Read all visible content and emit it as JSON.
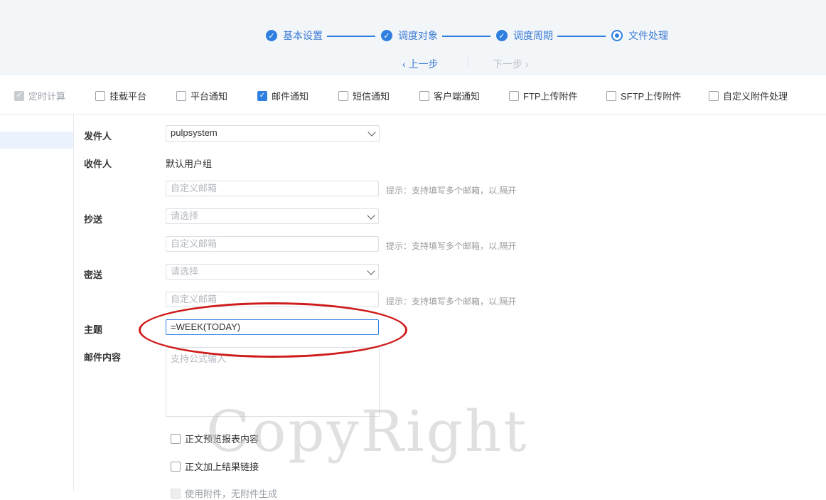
{
  "wizard": {
    "steps": [
      {
        "label": "基本设置"
      },
      {
        "label": "调度对象"
      },
      {
        "label": "调度周期"
      },
      {
        "label": "文件处理"
      }
    ],
    "prev_label": "上一步",
    "next_label": "下一步"
  },
  "options": [
    {
      "label": "定时计算",
      "checked": true,
      "disabled": true
    },
    {
      "label": "挂载平台",
      "checked": false
    },
    {
      "label": "平台通知",
      "checked": false
    },
    {
      "label": "邮件通知",
      "checked": true
    },
    {
      "label": "短信通知",
      "checked": false
    },
    {
      "label": "客户端通知",
      "checked": false
    },
    {
      "label": "FTP上传附件",
      "checked": false
    },
    {
      "label": "SFTP上传附件",
      "checked": false
    },
    {
      "label": "自定义附件处理",
      "checked": false
    }
  ],
  "form": {
    "sender_label": "发件人",
    "sender_value": "pulpsystem",
    "recipient_label": "收件人",
    "recipient_group": "默认用户组",
    "custom_email_placeholder": "自定义邮箱",
    "hint": "提示：支持填写多个邮箱，以,隔开",
    "cc_label": "抄送",
    "select_placeholder": "请选择",
    "bcc_label": "密送",
    "subject_label": "主题",
    "subject_value": "=WEEK(TODAY)",
    "content_label": "邮件内容",
    "content_placeholder": "支持公式输入",
    "preview_label": "正文预览报表内容",
    "link_label": "正文加上结果链接",
    "attach_label": "使用附件，无附件生成"
  },
  "watermark": "CopyRight",
  "colors": {
    "accent": "#2f7fe0",
    "highlight": "#cf1b1b"
  }
}
